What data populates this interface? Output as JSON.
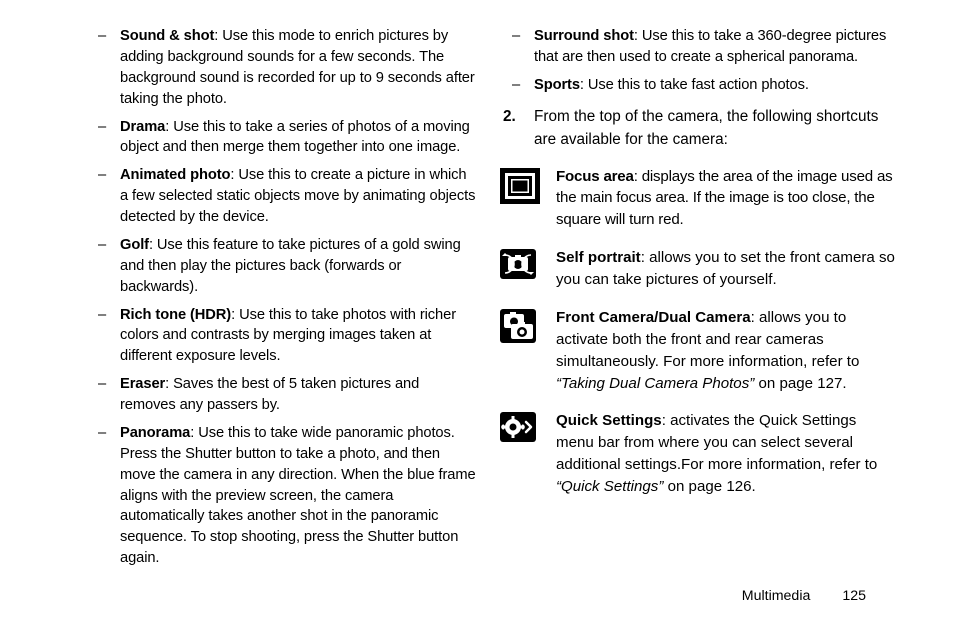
{
  "left_modes": [
    {
      "term": "Sound & shot",
      "desc": ": Use this mode to enrich pictures by adding background sounds for a few seconds. The background sound is recorded for up to 9 seconds after taking the photo."
    },
    {
      "term": "Drama",
      "desc": ": Use this to take a series of photos of a moving object and then merge them together into one image."
    },
    {
      "term": "Animated photo",
      "desc": ": Use this to create a picture in which a few selected static objects move by animating objects detected by the device."
    },
    {
      "term": "Golf",
      "desc": ": Use this feature to take pictures of a gold swing and then play the pictures back (forwards or backwards)."
    },
    {
      "term": "Rich tone (HDR)",
      "desc": ": Use this to take photos with richer colors and contrasts by merging images taken at different exposure levels."
    },
    {
      "term": "Eraser",
      "desc": ": Saves the best of 5 taken pictures and removes any passers by."
    },
    {
      "term": "Panorama",
      "desc": ": Use this to take wide panoramic photos. Press the Shutter button to take a photo, and then move the camera in any direction. When the blue frame aligns with the preview screen, the camera automatically takes another shot in the panoramic sequence. To stop shooting, press the Shutter button again."
    }
  ],
  "right_modes": [
    {
      "term": "Surround shot",
      "desc": ": Use this to take a 360-degree pictures that are then used to create a spherical panorama."
    },
    {
      "term": "Sports",
      "desc": ": Use this to take fast action photos."
    }
  ],
  "step2": {
    "num": "2.",
    "text": "From the top of the camera, the following shortcuts are available for the camera:"
  },
  "shortcuts": [
    {
      "icon": "focus-area-icon",
      "term": "Focus area",
      "desc": ": displays the area of the image used as the main focus area. If the image is too close, the square will turn red."
    },
    {
      "icon": "self-portrait-icon",
      "term": "Self portrait",
      "desc": ": allows you to set the front camera so you can take pictures of yourself."
    },
    {
      "icon": "dual-camera-icon",
      "term": "Front Camera/Dual Camera",
      "desc": ": allows you to activate both the front and rear cameras simultaneously. For more information, refer to ",
      "ref": "“Taking Dual Camera Photos”",
      "tail": "  on page 127."
    },
    {
      "icon": "quick-settings-icon",
      "term": "Quick Settings",
      "desc": ": activates the Quick Settings menu bar from where you can select several additional settings.For more information, refer to ",
      "ref": "“Quick Settings”",
      "tail": "  on page 126."
    }
  ],
  "footer": {
    "section": "Multimedia",
    "page": "125"
  }
}
